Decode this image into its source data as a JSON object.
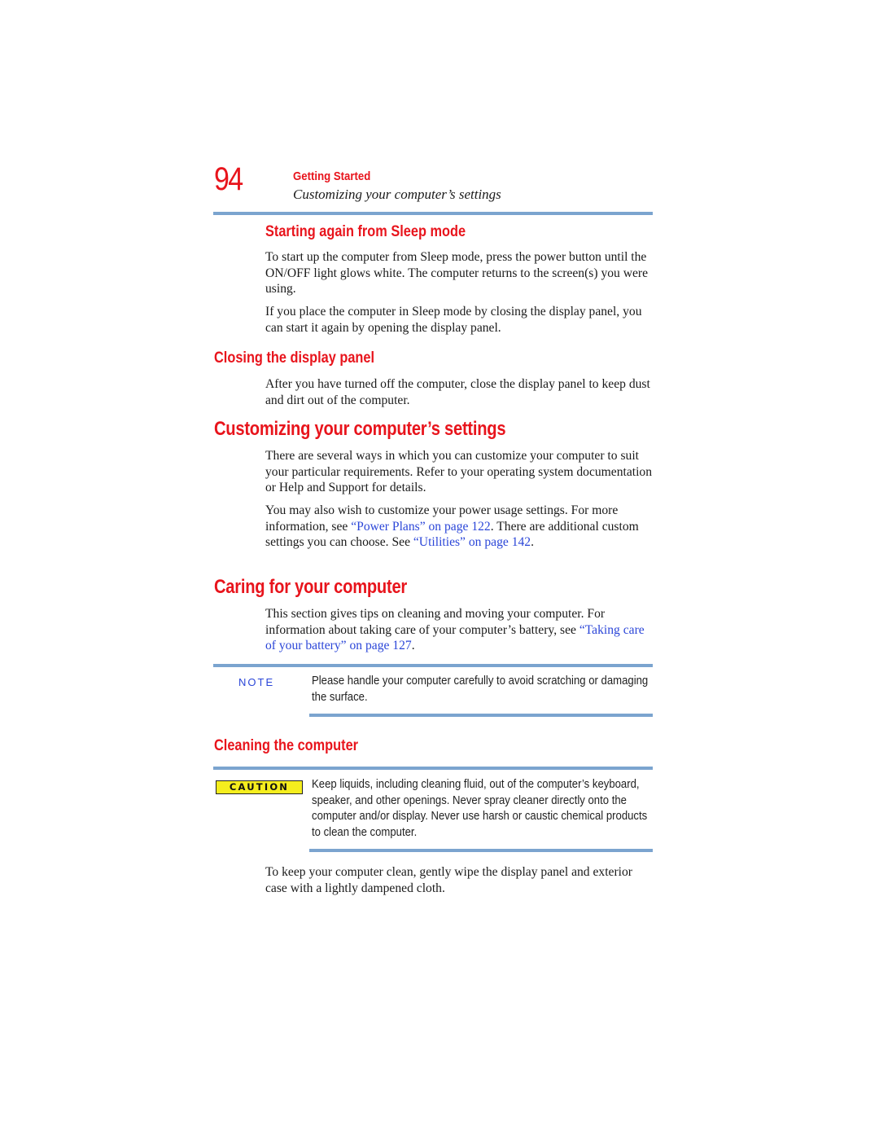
{
  "header": {
    "page_number": "94",
    "chapter": "Getting Started",
    "section": "Customizing your computer’s settings"
  },
  "sections": {
    "sleep": {
      "heading": "Starting again from Sleep mode",
      "p1": "To start up the computer from Sleep mode, press the power button until the ON/OFF light glows white. The computer returns to the screen(s) you were using.",
      "p2": "If you place the computer in Sleep mode by closing the display panel, you can start it again by opening the display panel."
    },
    "closing": {
      "heading": "Closing the display panel",
      "p1": "After you have turned off the computer, close the display panel to keep dust and dirt out of the computer."
    },
    "customizing": {
      "heading": "Customizing your computer’s settings",
      "p1": "There are several ways in which you can customize your computer to suit your particular requirements. Refer to your operating system documentation or Help and Support for details.",
      "p2_a": "You may also wish to customize your power usage settings. For more information, see ",
      "p2_link1": "“Power Plans” on page 122",
      "p2_b": ". There are additional custom settings you can choose. See ",
      "p2_link2": "“Utilities” on page 142",
      "p2_c": "."
    },
    "caring": {
      "heading": "Caring for your computer",
      "p1_a": "This section gives tips on cleaning and moving your computer. For information about taking care of your computer’s battery, see ",
      "p1_link": "“Taking care of your battery” on page 127",
      "p1_b": "."
    },
    "note": {
      "label": "NOTE",
      "text": "Please handle your computer carefully to avoid scratching or damaging the surface."
    },
    "cleaning": {
      "heading": "Cleaning the computer",
      "caution_label": "CAUTION",
      "caution_text": "Keep liquids, including cleaning fluid, out of the computer’s keyboard, speaker, and other openings. Never spray cleaner directly onto the computer and/or display. Never use harsh or caustic chemical products to clean the computer.",
      "p1": "To keep your computer clean, gently wipe the display panel and exterior case with a lightly dampened cloth."
    }
  },
  "colors": {
    "heading_red": "#e8141c",
    "link_blue": "#2b46d8",
    "rule_blue": "#7ba4cf",
    "caution_yellow": "#f5ee1e"
  }
}
